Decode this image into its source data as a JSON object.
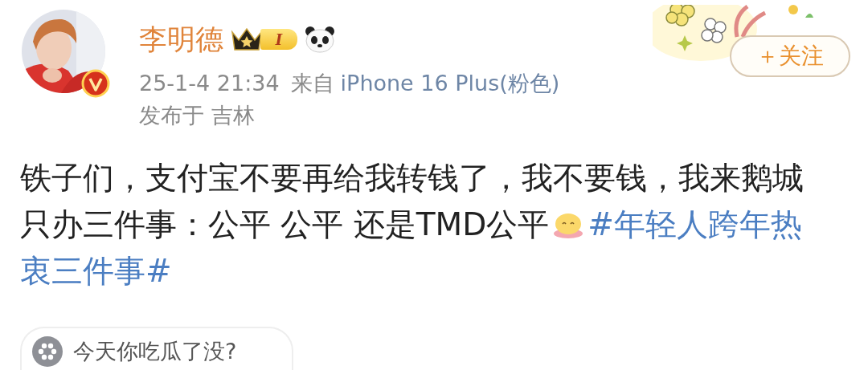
{
  "author": {
    "name": "李明德",
    "member_level": "I",
    "verified": true
  },
  "follow_button": {
    "label": "＋关注"
  },
  "meta": {
    "time": "25-1-4 21:34",
    "source_prefix": "来自",
    "source": "iPhone 16 Plus(粉色)",
    "location": "发布于 吉林"
  },
  "post": {
    "lines": [
      "铁子们，支付宝不要再给我转钱了，我不要钱，我来鹅城",
      "只办三件事：公平 公平 还是TMD公平"
    ],
    "hashtag_lines": [
      "#年轻人跨年热",
      "衷三件事#"
    ]
  },
  "comment_prompt": {
    "placeholder": "今天你吃瓜了没?"
  }
}
